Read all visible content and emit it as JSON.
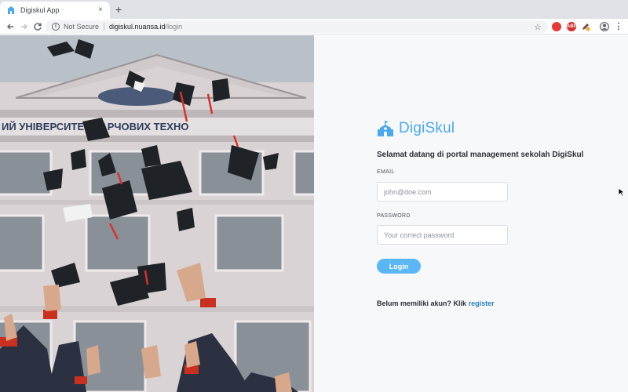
{
  "browser": {
    "tab_title": "Digiskul App",
    "tab_close": "×",
    "new_tab": "+",
    "security_label": "Not Secure",
    "url_host": "digiskul.nuansa.id",
    "url_path": "/login",
    "icons": [
      "back-icon",
      "forward-icon",
      "reload-icon",
      "info-icon",
      "star-icon",
      "menu-icon"
    ],
    "extensions": [
      {
        "name": "extension-red-icon",
        "label": "",
        "color": "#e53935"
      },
      {
        "name": "adblock-icon",
        "label": "ABP",
        "color": "#d32f2f"
      },
      {
        "name": "extension-pencil-icon",
        "label": "",
        "color": "#f9a825"
      },
      {
        "name": "profile-avatar",
        "label": "",
        "color": "#5f6368"
      }
    ]
  },
  "brand": {
    "name": "DigiSkul",
    "color": "#4aa9f0"
  },
  "login": {
    "welcome": "Selamat datang di portal management sekolah DigiSkul",
    "email_label": "EMAIL",
    "email_placeholder": "john@doe.com",
    "email_value": "",
    "password_label": "PASSWORD",
    "password_placeholder": "Your correct password",
    "password_value": "",
    "submit_label": "Login",
    "register_prompt": "Belum memiliki akun? Klik",
    "register_link": "register"
  },
  "colors": {
    "accent": "#5bb6f6",
    "link": "#2b7fc4",
    "panel_bg": "#f7f8fa"
  }
}
